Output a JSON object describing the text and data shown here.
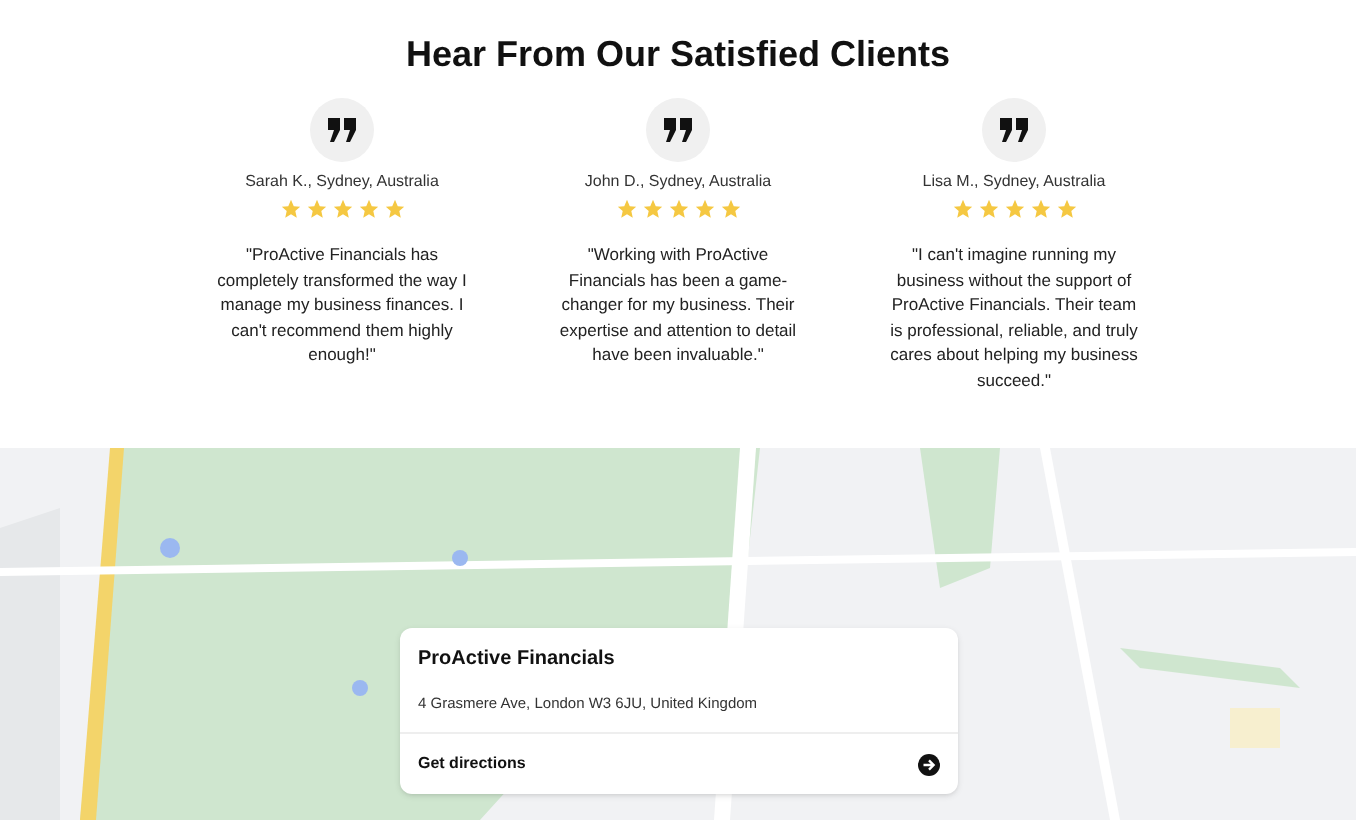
{
  "heading": "Hear From Our Satisfied Clients",
  "testimonials": [
    {
      "author": "Sarah K., Sydney, Australia",
      "stars": 5,
      "quote": "\"ProActive Financials has completely transformed the way I manage my business finances. I can't recommend them highly enough!\""
    },
    {
      "author": "John D., Sydney, Australia",
      "stars": 5,
      "quote": "\"Working with ProActive Financials has been a game-changer for my business. Their expertise and attention to detail have been invaluable.\""
    },
    {
      "author": "Lisa M., Sydney, Australia",
      "stars": 5,
      "quote": "\"I can't imagine running my business without the support of ProActive Financials. Their team is professional, reliable, and truly cares about helping my business succeed.\""
    }
  ],
  "map_card": {
    "title": "ProActive Financials",
    "address": "4 Grasmere Ave, London W3 6JU, United Kingdom",
    "link": "Get directions"
  }
}
